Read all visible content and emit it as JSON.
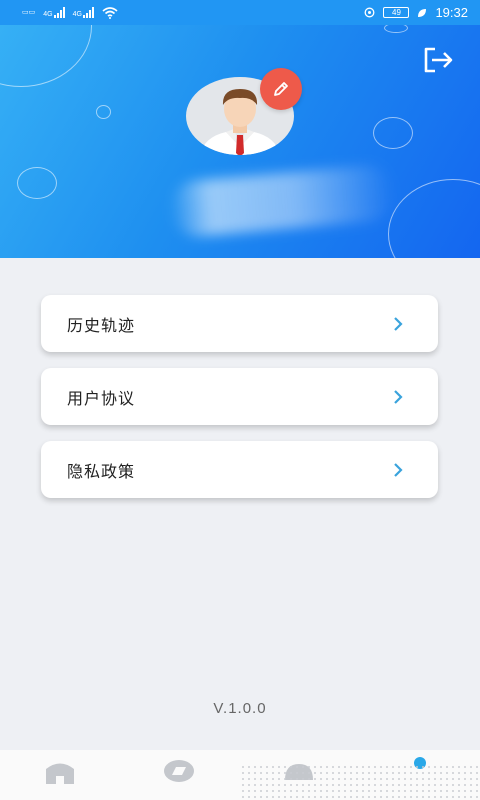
{
  "status_bar": {
    "time": "19:32",
    "network_label_1": "4G",
    "network_label_2": "4G",
    "battery_level": "49"
  },
  "header": {
    "logout_icon": "logout-icon",
    "edit_icon": "pencil-icon"
  },
  "menu": {
    "items": [
      {
        "label": "历史轨迹"
      },
      {
        "label": "用户协议"
      },
      {
        "label": "隐私政策"
      }
    ]
  },
  "version": "V.1.0.0",
  "tabs": [
    {
      "icon": "home-icon",
      "active": false
    },
    {
      "icon": "compass-icon",
      "active": false
    },
    {
      "icon": "speedometer-icon",
      "active": false
    },
    {
      "icon": "profile-icon",
      "active": true
    }
  ],
  "colors": {
    "primary": "#2196f3",
    "edit_badge": "#ee5a4a",
    "chevron": "#3aa3dc",
    "active_dot": "#2aa8e8"
  }
}
